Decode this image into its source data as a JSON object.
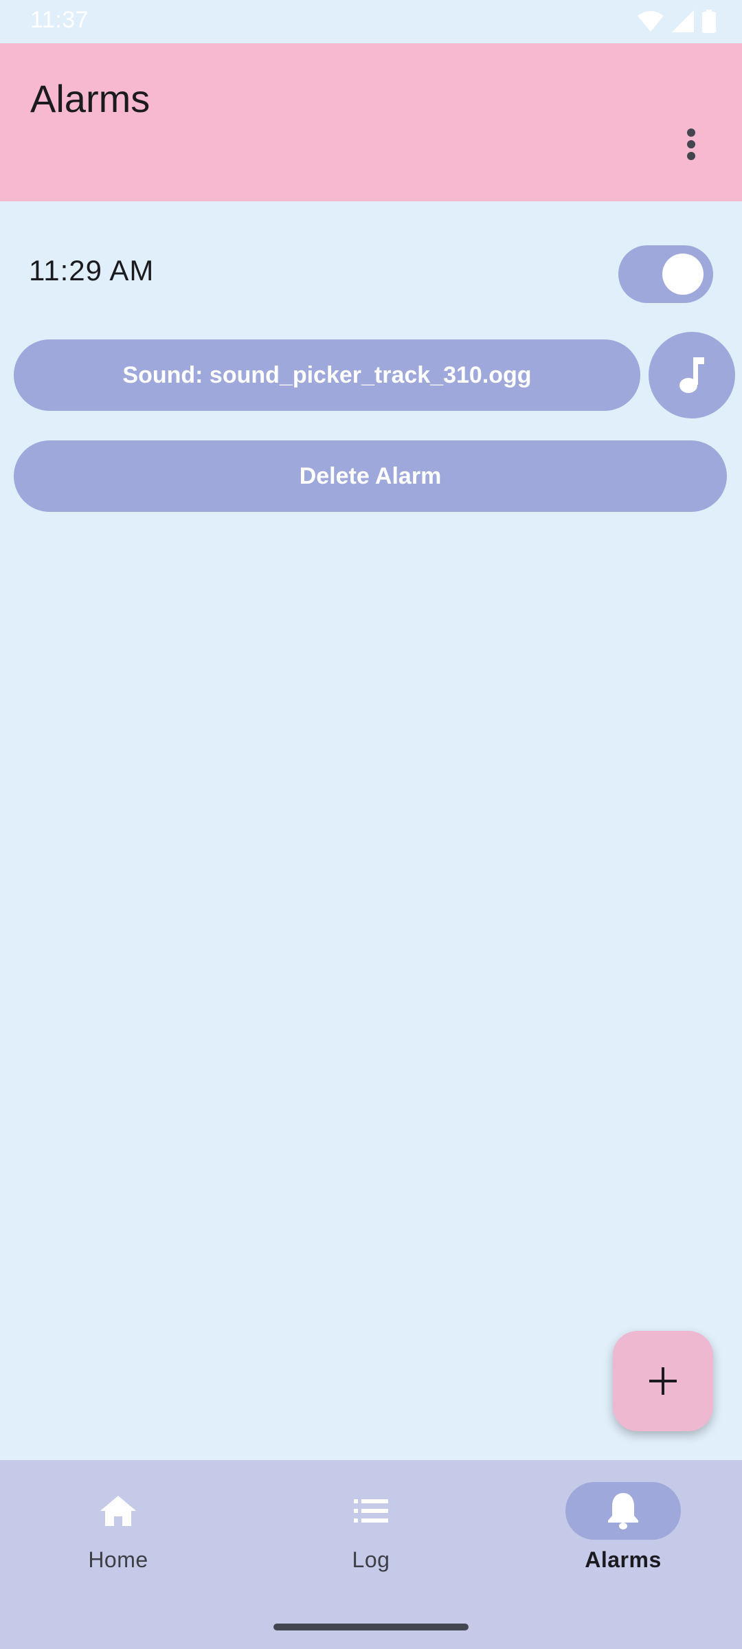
{
  "status_bar": {
    "time": "11:37",
    "icons": [
      "wifi-icon",
      "cell-signal-icon",
      "battery-icon"
    ]
  },
  "app_bar": {
    "title": "Alarms",
    "menu_icon": "more-vert-icon"
  },
  "alarm": {
    "time": "11:29 AM",
    "enabled": true,
    "sound_label": "Sound: sound_picker_track_310.ogg",
    "music_icon": "music-note-icon",
    "delete_label": "Delete Alarm"
  },
  "fab": {
    "icon": "plus-icon"
  },
  "bottom_nav": {
    "items": [
      {
        "label": "Home",
        "icon": "home-icon",
        "active": false
      },
      {
        "label": "Log",
        "icon": "list-icon",
        "active": false
      },
      {
        "label": "Alarms",
        "icon": "bell-icon",
        "active": true
      }
    ]
  },
  "colors": {
    "background": "#E1EFFB",
    "app_bar": "#F6B9CF",
    "accent": "#9FA8DA",
    "fab": "#EDB8D0",
    "bottom_nav": "#C5CAE9"
  }
}
